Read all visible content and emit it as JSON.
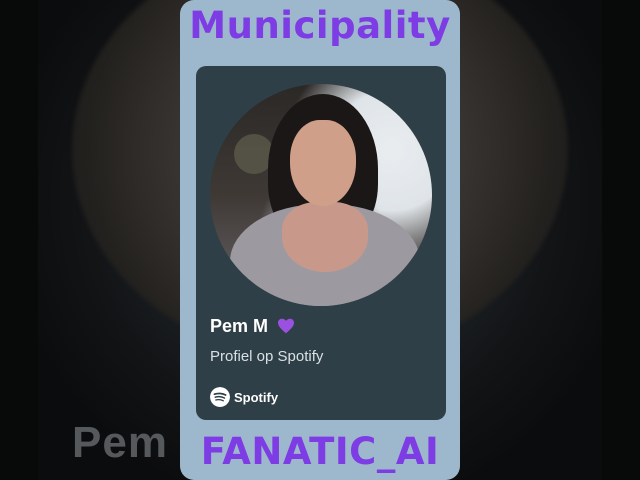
{
  "header": {
    "title": "Municipality"
  },
  "footer": {
    "title": "FANATIC_AI"
  },
  "background": {
    "ghost_text": "Pem"
  },
  "card": {
    "name": "Pem M",
    "emoji_icon": "purple-heart-icon",
    "subtitle": "Profiel op Spotify",
    "brand": "Spotify"
  },
  "colors": {
    "title": "#7d3ce4",
    "panel": "#9db8cd",
    "card": "#2f3f47",
    "heart": "#9b51e0"
  }
}
